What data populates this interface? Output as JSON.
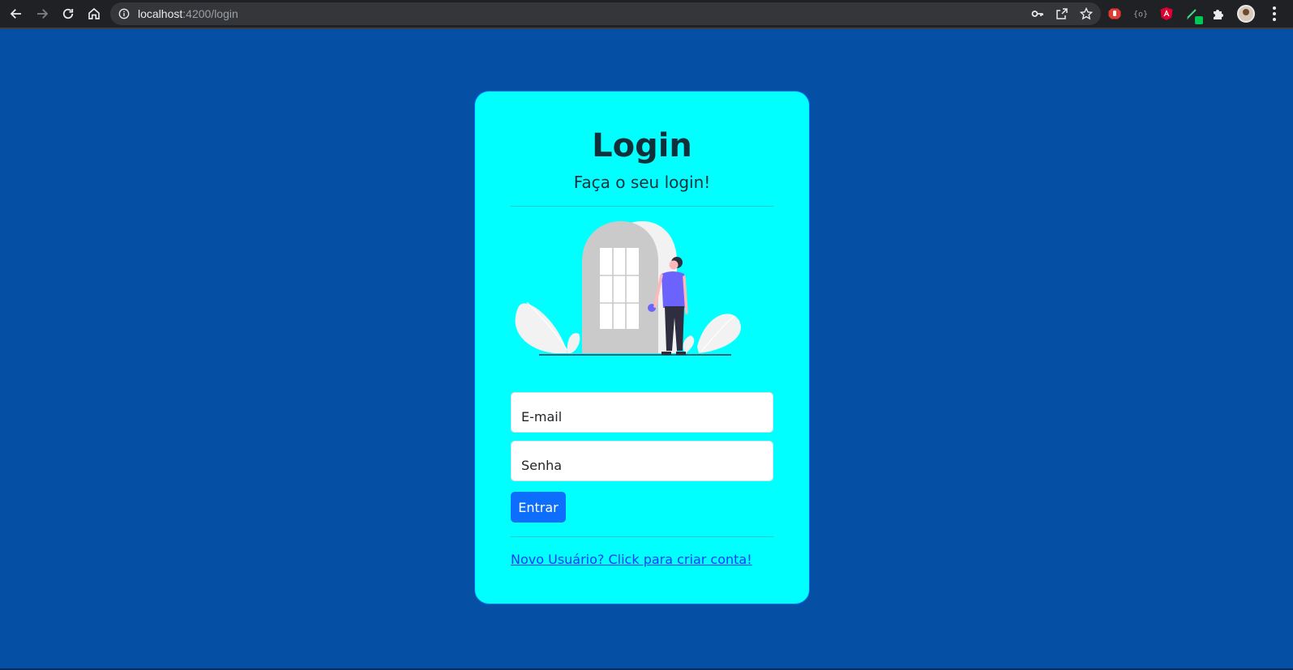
{
  "browser": {
    "url_host": "localhost",
    "url_path": ":4200/login",
    "nav_icons": [
      "back-arrow-icon",
      "forward-arrow-icon",
      "reload-icon",
      "home-icon"
    ],
    "omnibox_icons": [
      "key-icon",
      "share-icon",
      "star-icon"
    ],
    "extension_icons": [
      "stop-hand-icon",
      "braces-icon",
      "angular-icon",
      "edit-badge-icon",
      "puzzle-icon"
    ]
  },
  "page": {
    "background_color": "#0550a5",
    "card_color": "#00ffff",
    "accent_color": "#0d6efd"
  },
  "login": {
    "title": "Login",
    "subtitle": "Faça o seu login!",
    "email_placeholder": "E-mail",
    "password_placeholder": "Senha",
    "submit_label": "Entrar",
    "register_link": "Novo Usuário? Click para criar conta!"
  }
}
